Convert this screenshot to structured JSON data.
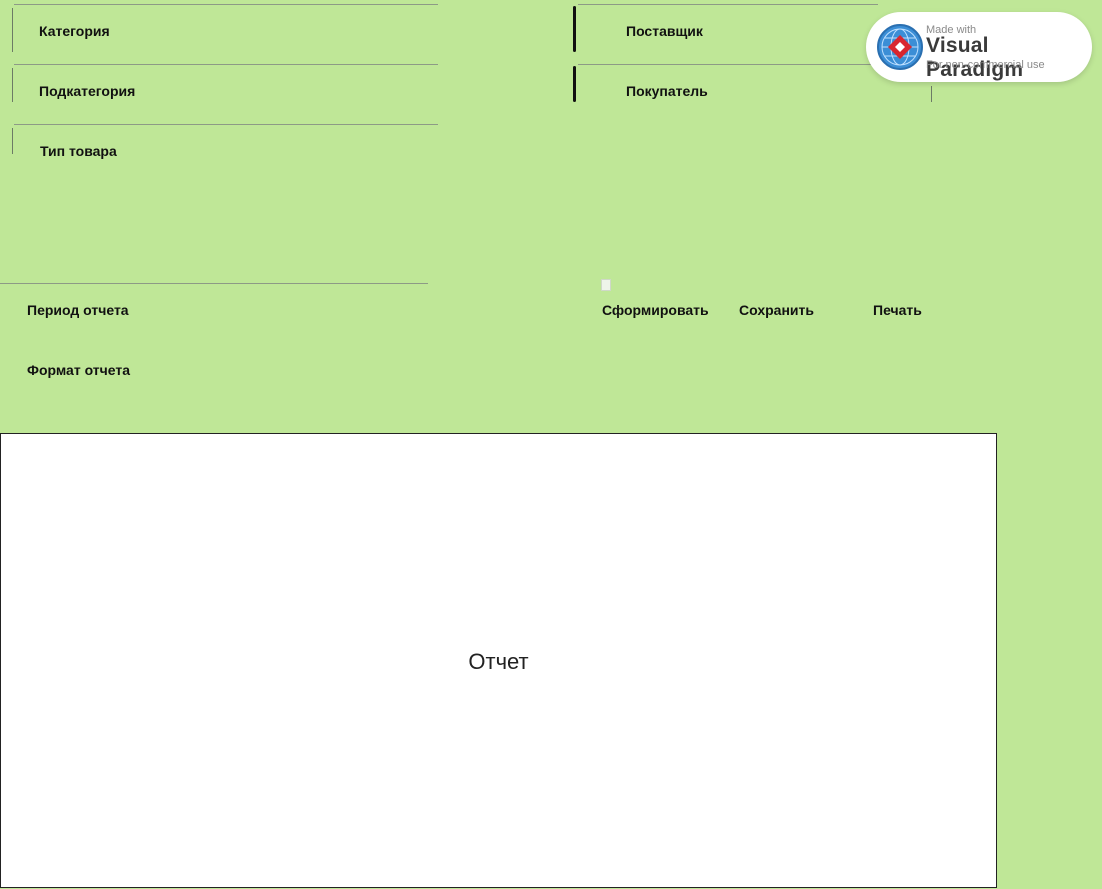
{
  "filters": {
    "category": "Категория",
    "subcategory": "Подкатегория",
    "product_type": "Тип товара",
    "supplier": "Поставщик",
    "buyer": "Покупатель"
  },
  "settings": {
    "period": "Период отчета",
    "format": "Формат отчета"
  },
  "actions": {
    "generate": "Сформировать",
    "save": "Сохранить",
    "print": "Печать"
  },
  "report": {
    "title": "Отчет"
  },
  "watermark": {
    "made_with": "Made with",
    "brand": "Visual Paradigm",
    "note": "For non-commercial use"
  }
}
